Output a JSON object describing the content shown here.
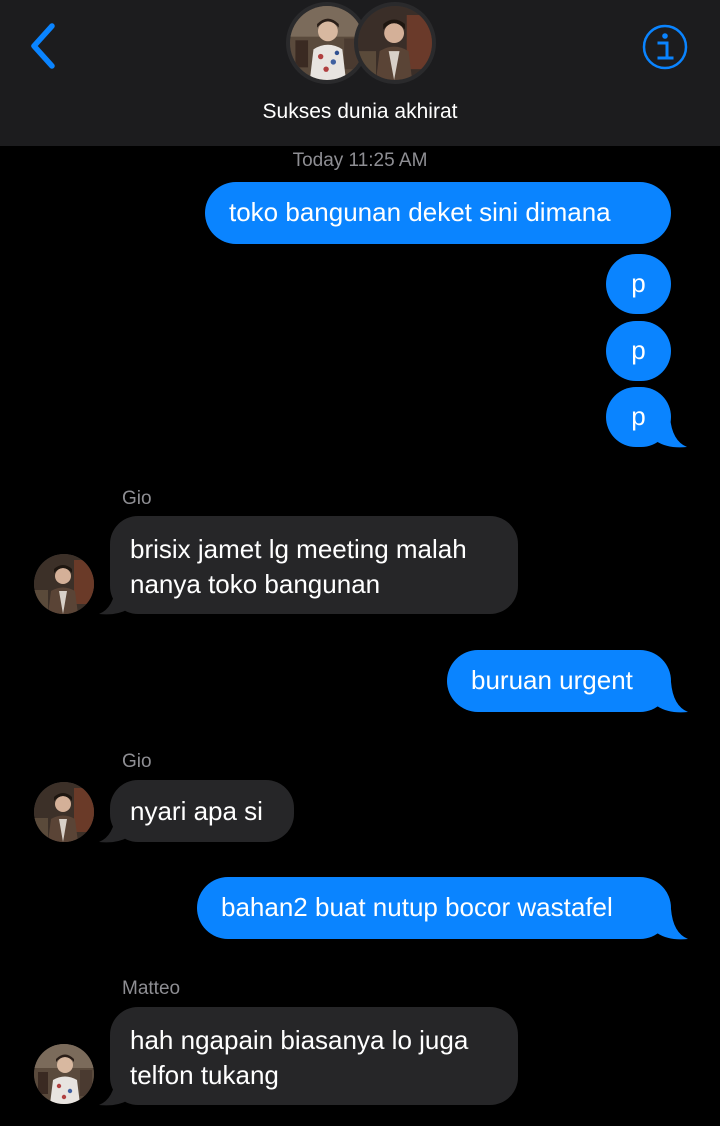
{
  "header": {
    "group_name": "Sukses dunia akhirat",
    "back_icon": "chevron-left-icon",
    "info_icon": "info-icon",
    "accent_color": "#0a84ff"
  },
  "conversation": {
    "timestamp": "Today 11:25 AM",
    "messages": [
      {
        "dir": "out",
        "text": "toko bangunan deket sini dimana"
      },
      {
        "dir": "out",
        "text": "p"
      },
      {
        "dir": "out",
        "text": "p"
      },
      {
        "dir": "out",
        "text": "p"
      },
      {
        "dir": "in",
        "sender": "Gio",
        "lines": [
          "brisix jamet lg meeting malah",
          "nanya toko bangunan"
        ]
      },
      {
        "dir": "out",
        "text": "buruan urgent"
      },
      {
        "dir": "in",
        "sender": "Gio",
        "lines": [
          "nyari apa si"
        ]
      },
      {
        "dir": "out",
        "text": "bahan2 buat nutup bocor wastafel"
      },
      {
        "dir": "in",
        "sender": "Matteo",
        "lines": [
          "hah ngapain biasanya lo juga",
          "telfon tukang"
        ]
      }
    ]
  },
  "colors": {
    "outgoing_bubble": "#0a84ff",
    "incoming_bubble": "#262628",
    "header_bg": "#1c1c1e",
    "meta_text": "#8e8e93"
  }
}
